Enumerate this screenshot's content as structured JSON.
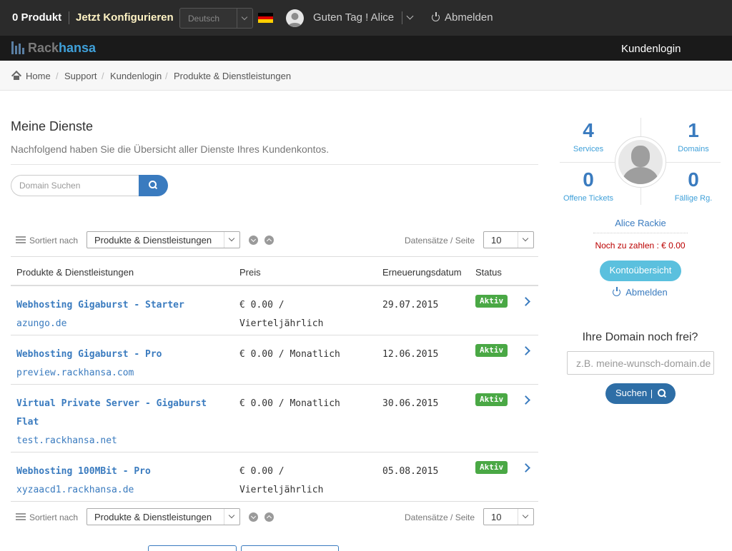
{
  "topbar": {
    "cart": "0 Produkt",
    "configure": "Jetzt Konfigurieren",
    "language": "Deutsch",
    "greeting": "Guten Tag ! Alice",
    "logout": "Abmelden",
    "flag_colors": [
      "#000000",
      "#dd0000",
      "#ffce00"
    ]
  },
  "logobar": {
    "logo_part1": "Rack",
    "logo_part2": "hansa",
    "nav_login": "Kundenlogin"
  },
  "breadcrumb": [
    "Home",
    "Support",
    "Kundenlogin",
    "Produkte & Dienstleistungen"
  ],
  "main": {
    "title": "Meine Dienste",
    "subtitle": "Nachfolgend haben Sie die Übersicht aller Dienste Ihres Kundenkontos.",
    "search_placeholder": "Domain Suchen",
    "sort_label": "Sortiert nach",
    "sort_value": "Produkte & Dienstleistungen",
    "per_page_label": "Datensätze / Seite",
    "per_page_value": "10"
  },
  "table": {
    "headers": [
      "Produkte & Dienstleistungen",
      "Preis",
      "Erneuerungsdatum",
      "Status"
    ],
    "rows": [
      {
        "name": "Webhosting Gigaburst - Starter",
        "domain": "azungo.de",
        "price": "€ 0.00 / Vierteljährlich",
        "date": "29.07.2015",
        "status": "Aktiv"
      },
      {
        "name": "Webhosting Gigaburst - Pro",
        "domain": "preview.rackhansa.com",
        "price": "€ 0.00 / Monatlich",
        "date": "12.06.2015",
        "status": "Aktiv"
      },
      {
        "name": "Virtual Private Server - Gigaburst Flat",
        "domain": "test.rackhansa.net",
        "price": "€ 0.00 / Monatlich",
        "date": "30.06.2015",
        "status": "Aktiv"
      },
      {
        "name": "Webhosting 100MBit - Pro",
        "domain": "xyzaacd1.rackhansa.de",
        "price": "€ 0.00 / Vierteljährlich",
        "date": "05.08.2015",
        "status": "Aktiv"
      }
    ]
  },
  "sidebar": {
    "services_count": "4",
    "services_label": "Services",
    "domains_count": "1",
    "domains_label": "Domains",
    "tickets_count": "0",
    "tickets_label": "Offene Tickets",
    "invoices_count": "0",
    "invoices_label": "Fällige Rg.",
    "user_name": "Alice Rackie",
    "due_text": "Noch zu zahlen : € 0.00",
    "overview_button": "Kontoübersicht",
    "logout": "Abmelden",
    "domain_title": "Ihre Domain noch frei?",
    "domain_placeholder": "z.B. meine-wunsch-domain.de",
    "domain_button": "Suchen"
  }
}
